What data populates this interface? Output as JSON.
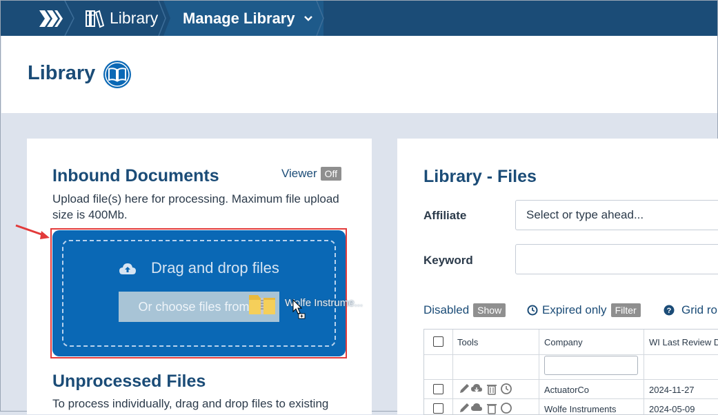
{
  "nav": {
    "library_label": "Library",
    "manage_label": "Manage Library"
  },
  "header": {
    "title": "Library"
  },
  "inbound": {
    "title": "Inbound Documents",
    "viewer_label": "Viewer",
    "viewer_state": "Off",
    "description": "Upload file(s) here for processing. Maximum file upload size is 400Mb.",
    "dropzone_title": "Drag and drop files",
    "choose_button": "Or choose files from d",
    "dragged_file": "Wolfe Instrume..."
  },
  "unprocessed": {
    "title": "Unprocessed Files",
    "description": "To process individually, drag and drop files to existing"
  },
  "library_files": {
    "title": "Library - Files",
    "affiliate_label": "Affiliate",
    "affiliate_placeholder": "Select or type ahead...",
    "keyword_label": "Keyword",
    "keyword_value": "",
    "disabled_label": "Disabled",
    "disabled_button": "Show",
    "expired_label": "Expired only",
    "expired_button": "Filter",
    "grid_label": "Grid ro"
  },
  "table": {
    "columns": [
      "Tools",
      "Company",
      "WI Last Review D"
    ],
    "rows": [
      {
        "company": "ActuatorCo",
        "date": "2024-11-27"
      },
      {
        "company": "Wolfe Instruments",
        "date": "2024-05-09"
      }
    ]
  },
  "colors": {
    "nav_bg": "#1b4c77",
    "accent": "#0a68b5",
    "title": "#1b4c77",
    "highlight": "#e23a3a"
  }
}
